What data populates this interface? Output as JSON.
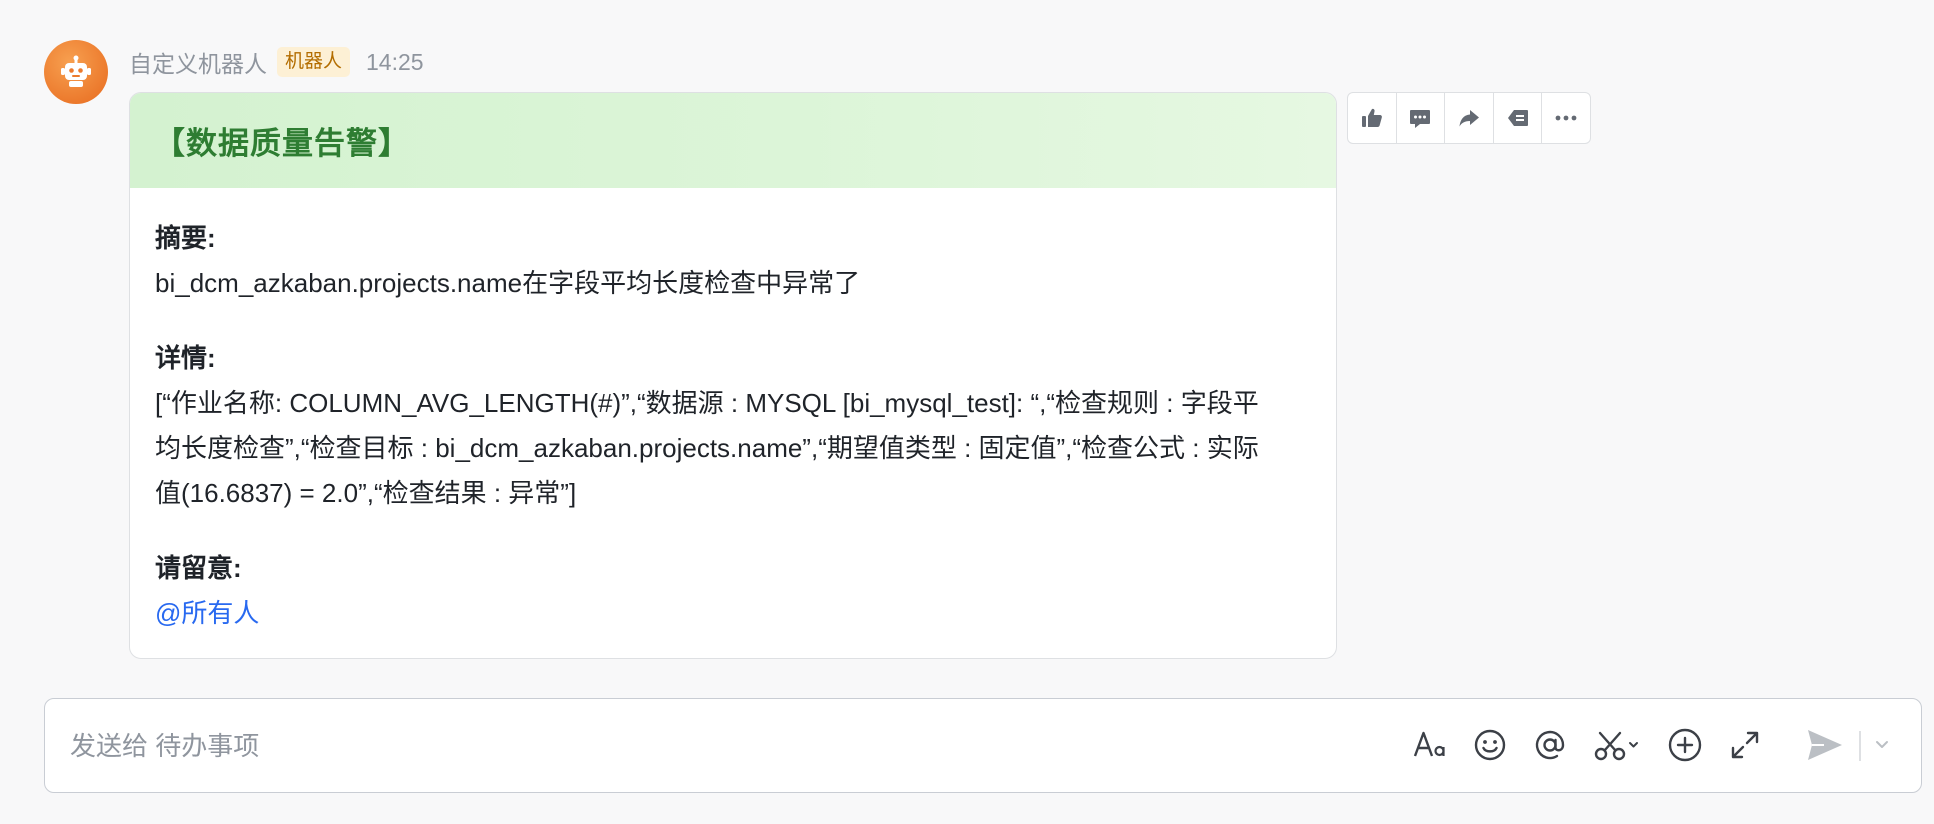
{
  "message": {
    "sender": "自定义机器人",
    "badge": "机器人",
    "time": "14:25",
    "avatar_icon": "robot-icon",
    "avatar_color": "#ec7a2d"
  },
  "card": {
    "title": "【数据质量告警】",
    "header_color": "#d4f2d0",
    "title_color": "#2e7d32",
    "summary_label": "摘要:",
    "summary_text": "bi_dcm_azkaban.projects.name在字段平均长度检查中异常了",
    "details_label": "详情:",
    "details_text": "[“作业名称: COLUMN_AVG_LENGTH(#)”,“数据源 : MYSQL [bi_mysql_test]: “,“检查规则 : 字段平均长度检查”,“检查目标 : bi_dcm_azkaban.projects.name”,“期望值类型 : 固定值”,“检查公式 : 实际值(16.6837) = 2.0”,“检查结果 : 异常”]",
    "notice_label": "请留意:",
    "notice_mention": "@所有人",
    "mention_color": "#2869f0"
  },
  "actions": [
    {
      "icon": "thumbs-up-icon"
    },
    {
      "icon": "comment-icon"
    },
    {
      "icon": "forward-icon"
    },
    {
      "icon": "reply-icon"
    },
    {
      "icon": "more-icon"
    }
  ],
  "composer": {
    "placeholder": "发送给 待办事项",
    "tools": [
      "font-format-icon",
      "emoji-icon",
      "mention-icon",
      "screenshot-icon",
      "add-icon",
      "expand-icon",
      "send-icon",
      "send-options-chevron-icon"
    ]
  }
}
